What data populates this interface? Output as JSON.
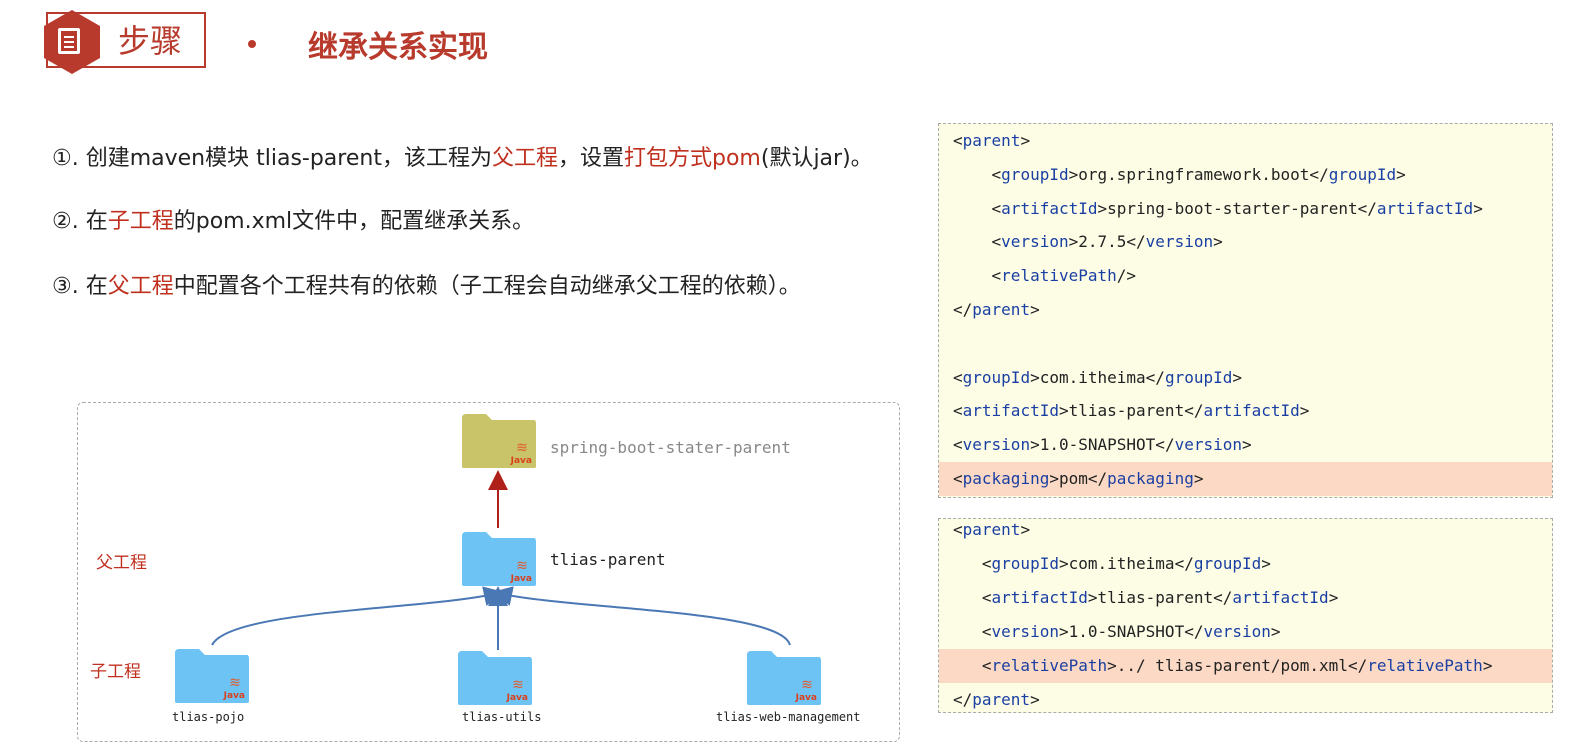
{
  "header": {
    "step_label": "步骤",
    "title": "继承关系实现"
  },
  "steps": [
    [
      [
        "n",
        "①. 创建maven模块 tlias-parent，该工程为"
      ],
      [
        "r",
        "父工程"
      ],
      [
        "n",
        "，设置"
      ],
      [
        "r",
        "打包方式pom"
      ],
      [
        "n",
        "(默认jar)。"
      ]
    ],
    [
      [
        "n",
        "②. 在"
      ],
      [
        "r",
        "子工程"
      ],
      [
        "n",
        "的pom.xml文件中，配置继承关系。"
      ]
    ],
    [
      [
        "n",
        "③. 在"
      ],
      [
        "r",
        "父工程"
      ],
      [
        "n",
        "中配置各个工程共有的依赖（子工程会自动继承父工程的依赖）。"
      ]
    ]
  ],
  "code_parent": [
    {
      "hl": false,
      "seg": [
        [
          "p",
          "<"
        ],
        [
          "t",
          "parent"
        ],
        [
          "p",
          ">"
        ]
      ]
    },
    {
      "hl": false,
      "seg": [
        [
          "p",
          "    <"
        ],
        [
          "t",
          "groupId"
        ],
        [
          "p",
          ">org.springframework.boot</"
        ],
        [
          "t",
          "groupId"
        ],
        [
          "p",
          ">"
        ]
      ]
    },
    {
      "hl": false,
      "seg": [
        [
          "p",
          "    <"
        ],
        [
          "t",
          "artifactId"
        ],
        [
          "p",
          ">spring-boot-starter-parent</"
        ],
        [
          "t",
          "artifactId"
        ],
        [
          "p",
          ">"
        ]
      ]
    },
    {
      "hl": false,
      "seg": [
        [
          "p",
          "    <"
        ],
        [
          "t",
          "version"
        ],
        [
          "p",
          ">2.7.5</"
        ],
        [
          "t",
          "version"
        ],
        [
          "p",
          ">"
        ]
      ]
    },
    {
      "hl": false,
      "seg": [
        [
          "p",
          "    <"
        ],
        [
          "t",
          "relativePath"
        ],
        [
          "p",
          "/>"
        ]
      ]
    },
    {
      "hl": false,
      "seg": [
        [
          "p",
          "</"
        ],
        [
          "t",
          "parent"
        ],
        [
          "p",
          ">"
        ]
      ]
    },
    {
      "hl": false,
      "seg": []
    },
    {
      "hl": false,
      "seg": [
        [
          "p",
          "<"
        ],
        [
          "t",
          "groupId"
        ],
        [
          "p",
          ">com.itheima</"
        ],
        [
          "t",
          "groupId"
        ],
        [
          "p",
          ">"
        ]
      ]
    },
    {
      "hl": false,
      "seg": [
        [
          "p",
          "<"
        ],
        [
          "t",
          "artifactId"
        ],
        [
          "p",
          ">tlias-parent</"
        ],
        [
          "t",
          "artifactId"
        ],
        [
          "p",
          ">"
        ]
      ]
    },
    {
      "hl": false,
      "seg": [
        [
          "p",
          "<"
        ],
        [
          "t",
          "version"
        ],
        [
          "p",
          ">1.0-SNAPSHOT</"
        ],
        [
          "t",
          "version"
        ],
        [
          "p",
          ">"
        ]
      ]
    },
    {
      "hl": true,
      "seg": [
        [
          "p",
          "<"
        ],
        [
          "t",
          "packaging"
        ],
        [
          "p",
          ">pom</"
        ],
        [
          "t",
          "packaging"
        ],
        [
          "p",
          ">"
        ]
      ]
    }
  ],
  "code_child": [
    {
      "hl": false,
      "seg": [
        [
          "p",
          "<"
        ],
        [
          "t",
          "parent"
        ],
        [
          "p",
          ">"
        ]
      ]
    },
    {
      "hl": false,
      "seg": [
        [
          "p",
          "   <"
        ],
        [
          "t",
          "groupId"
        ],
        [
          "p",
          ">com.itheima</"
        ],
        [
          "t",
          "groupId"
        ],
        [
          "p",
          ">"
        ]
      ]
    },
    {
      "hl": false,
      "seg": [
        [
          "p",
          "   <"
        ],
        [
          "t",
          "artifactId"
        ],
        [
          "p",
          ">tlias-parent</"
        ],
        [
          "t",
          "artifactId"
        ],
        [
          "p",
          ">"
        ]
      ]
    },
    {
      "hl": false,
      "seg": [
        [
          "p",
          "   <"
        ],
        [
          "t",
          "version"
        ],
        [
          "p",
          ">1.0-SNAPSHOT</"
        ],
        [
          "t",
          "version"
        ],
        [
          "p",
          ">"
        ]
      ]
    },
    {
      "hl": true,
      "seg": [
        [
          "p",
          "   <"
        ],
        [
          "t",
          "relativePath"
        ],
        [
          "p",
          ">../ tlias-parent/pom.xml</"
        ],
        [
          "t",
          "relativePath"
        ],
        [
          "p",
          ">"
        ]
      ]
    },
    {
      "hl": false,
      "seg": [
        [
          "p",
          "</"
        ],
        [
          "t",
          "parent"
        ],
        [
          "p",
          ">"
        ]
      ]
    }
  ],
  "diagram": {
    "parent_label": "父工程",
    "child_label": "子工程",
    "spring": "spring-boot-stater-parent",
    "parent": "tlias-parent",
    "children": [
      "tlias-pojo",
      "tlias-utils",
      "tlias-web-management"
    ],
    "java_badge": "Java",
    "colors": {
      "spring_folder": "#c9c46a",
      "project_folder": "#6ec3f5",
      "red_arrow": "#b0201a",
      "blue_arrow": "#4a78b5"
    }
  }
}
